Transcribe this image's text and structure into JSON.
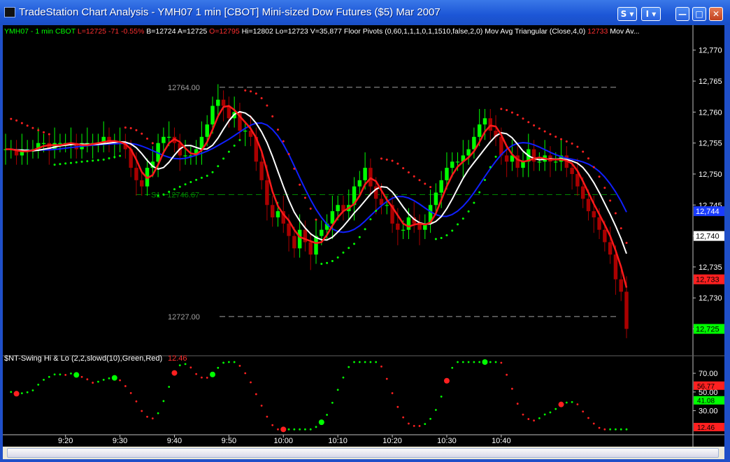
{
  "window": {
    "title": "TradeStation Chart Analysis - YMH07  1 min  [CBOT] Mini-sized Dow Futures ($5) Mar 2007",
    "btn_s": "S ▾",
    "btn_i": "I ▾",
    "btn_min": "—",
    "btn_max": "□",
    "btn_close": "✕"
  },
  "status": [
    {
      "text": "YMH07 - 1 min",
      "color": "#00ff00"
    },
    {
      "text": "CBOT",
      "color": "#00ff00"
    },
    {
      "text": "L=12725",
      "color": "#ff3030"
    },
    {
      "text": "-71",
      "color": "#ff3030"
    },
    {
      "text": "-0.55%",
      "color": "#ff3030"
    },
    {
      "text": "B=12724",
      "color": "#ffffff"
    },
    {
      "text": "A=12725",
      "color": "#ffffff"
    },
    {
      "text": "O=12795",
      "color": "#ff3030"
    },
    {
      "text": "Hi=12802",
      "color": "#ffffff"
    },
    {
      "text": "Lo=12723",
      "color": "#ffffff"
    },
    {
      "text": "V=35,877",
      "color": "#ffffff"
    },
    {
      "text": "Floor Pivots (0,60,1,1,1,0,1,1510,false,2,0)",
      "color": "#ffffff"
    },
    {
      "text": "Mov Avg Triangular (Close,4,0)",
      "color": "#ffffff"
    },
    {
      "text": "12733",
      "color": "#ff3030"
    },
    {
      "text": "Mov Av...",
      "color": "#ffffff"
    }
  ],
  "chart_data": {
    "type": "candlestick",
    "symbol": "YMH07",
    "interval": "1 min",
    "price_axis": {
      "ticks": [
        12770,
        12765,
        12760,
        12755,
        12750,
        12745,
        12740,
        12735,
        12730,
        12725
      ],
      "tick_labels": [
        "12,770",
        "12,765",
        "12,760",
        "12,755",
        "12,750",
        "12,745",
        "12,740",
        "12,735",
        "12,730",
        "12,725"
      ],
      "ylim": [
        12721,
        12772
      ]
    },
    "time_axis": {
      "labels": [
        "9:20",
        "9:30",
        "9:40",
        "9:50",
        "10:00",
        "10:10",
        "10:20",
        "10:30",
        "10:40"
      ],
      "start_minute": 9,
      "end_minute": 43
    },
    "price_tags": [
      {
        "value": 12744,
        "text": "12,744",
        "bg": "#1a3cff",
        "fg": "#ffffff"
      },
      {
        "value": 12740,
        "text": "12,740",
        "bg": "#ffffff",
        "fg": "#000000"
      },
      {
        "value": 12733,
        "text": "12,733",
        "bg": "#ff2020",
        "fg": "#000000"
      },
      {
        "value": 12725,
        "text": "12,725",
        "bg": "#00ff00",
        "fg": "#000000"
      }
    ],
    "pivot_lines": [
      {
        "value": 12764,
        "label": "12764.00",
        "color": "#a0a0a0"
      },
      {
        "value": 12746.67,
        "label": "S1 - 12746.67",
        "color": "#008800"
      },
      {
        "value": 12727,
        "label": "12727.00",
        "color": "#a0a0a0"
      }
    ],
    "closes": [
      12754,
      12754,
      12753,
      12754,
      12754,
      12754,
      12755,
      12755,
      12754,
      12755,
      12755,
      12755,
      12755,
      12754,
      12755,
      12755,
      12755,
      12755,
      12756,
      12755,
      12755,
      12755,
      12754,
      12751,
      12749,
      12748,
      12751,
      12752,
      12755,
      12756,
      12756,
      12755,
      12753,
      12753,
      12753,
      12754,
      12756,
      12758,
      12761,
      12762,
      12761,
      12759,
      12760,
      12757,
      12757,
      12756,
      12752,
      12749,
      12745,
      12743,
      12744,
      12742,
      12740,
      12738,
      12741,
      12739,
      12737,
      12740,
      12741,
      12742,
      12744,
      12745,
      12744,
      12745,
      12748,
      12749,
      12751,
      12748,
      12746,
      12745,
      12745,
      12742,
      12741,
      12741,
      12743,
      12742,
      12741,
      12742,
      12745,
      12747,
      12749,
      12751,
      12752,
      12752,
      12753,
      12754,
      12756,
      12758,
      12759,
      12757,
      12756,
      12753,
      12752,
      12753,
      12751,
      12752,
      12754,
      12752,
      12752,
      12753,
      12752,
      12752,
      12753,
      12751,
      12750,
      12748,
      12746,
      12744,
      12743,
      12741,
      12739,
      12737,
      12733,
      12731,
      12725
    ],
    "triangular_ma": [],
    "blue_ma": [],
    "sar_description": "parabolic-style dotted stop lines above and below price",
    "oscillator": {
      "label": "$NT-Swing Hi & Lo (2,2,slowd(10),Green,Red)",
      "last_value": "12.46",
      "axis_ticks": [
        70,
        50,
        30
      ],
      "tick_labels": [
        "70.00",
        "50.00",
        "30.00"
      ],
      "ylim": [
        5,
        85
      ],
      "tags": [
        {
          "value": 56.77,
          "text": "56.77",
          "bg": "#ff2020"
        },
        {
          "value": 41.08,
          "text": "41.08",
          "bg": "#00ff00"
        },
        {
          "value": 12.46,
          "text": "12.46",
          "bg": "#ff2020"
        }
      ],
      "swing_highs_minutes": [
        2,
        31,
        51,
        81,
        102
      ],
      "swing_lows_minutes": [
        13,
        20,
        38,
        58,
        88,
        121
      ]
    }
  },
  "colors": {
    "up": "#00ff00",
    "down": "#aa0000",
    "tri_ma": "#ff1a1a",
    "ma2": "#ffffff",
    "ma3": "#1020ff",
    "dot_red": "#ff2020",
    "dot_green": "#00ff00"
  }
}
